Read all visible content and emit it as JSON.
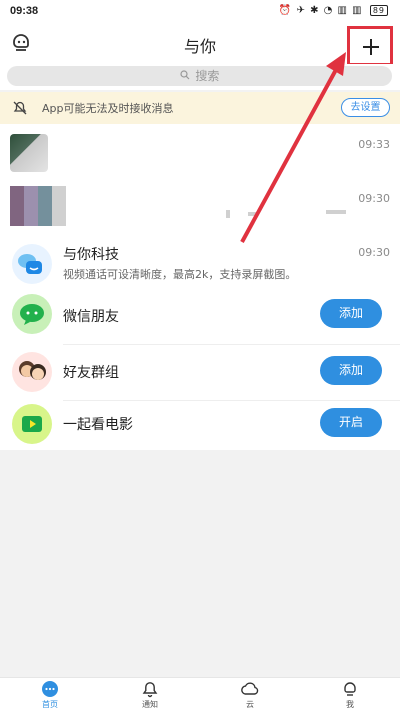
{
  "status_bar": {
    "time": "09:38",
    "icons": "⏰ ✈ ✱ ◔ ▥ ▥",
    "battery": "89"
  },
  "header": {
    "title": "与你",
    "left_icon": "robot-chat-icon",
    "right_icon": "plus-icon"
  },
  "search": {
    "placeholder": "搜索",
    "icon": "search-icon"
  },
  "notice": {
    "text": "App可能无法及时接收消息",
    "button": "去设置",
    "icon": "bell-off-icon"
  },
  "conversations": [
    {
      "name": "",
      "preview": "",
      "time": "09:33"
    },
    {
      "name": "",
      "preview": "",
      "time": "09:30"
    },
    {
      "name": "与你科技",
      "preview": "视频通话可设清晰度，最高2k，支持录屏截图。",
      "time": "09:30"
    }
  ],
  "features": [
    {
      "label": "微信朋友",
      "action": "添加",
      "icon": "wechat-icon"
    },
    {
      "label": "好友群组",
      "action": "添加",
      "icon": "friends-icon"
    },
    {
      "label": "一起看电影",
      "action": "开启",
      "icon": "movie-icon"
    }
  ],
  "tabs": [
    {
      "label": "首页",
      "icon": "home-chat-icon",
      "active": true
    },
    {
      "label": "通知",
      "icon": "bell-icon",
      "active": false
    },
    {
      "label": "云",
      "icon": "cloud-icon",
      "active": false
    },
    {
      "label": "我",
      "icon": "profile-icon",
      "active": false
    }
  ],
  "colors": {
    "accent": "#2f8fe0",
    "highlight": "#e0323f",
    "notice_bg": "#fbf4dd"
  }
}
